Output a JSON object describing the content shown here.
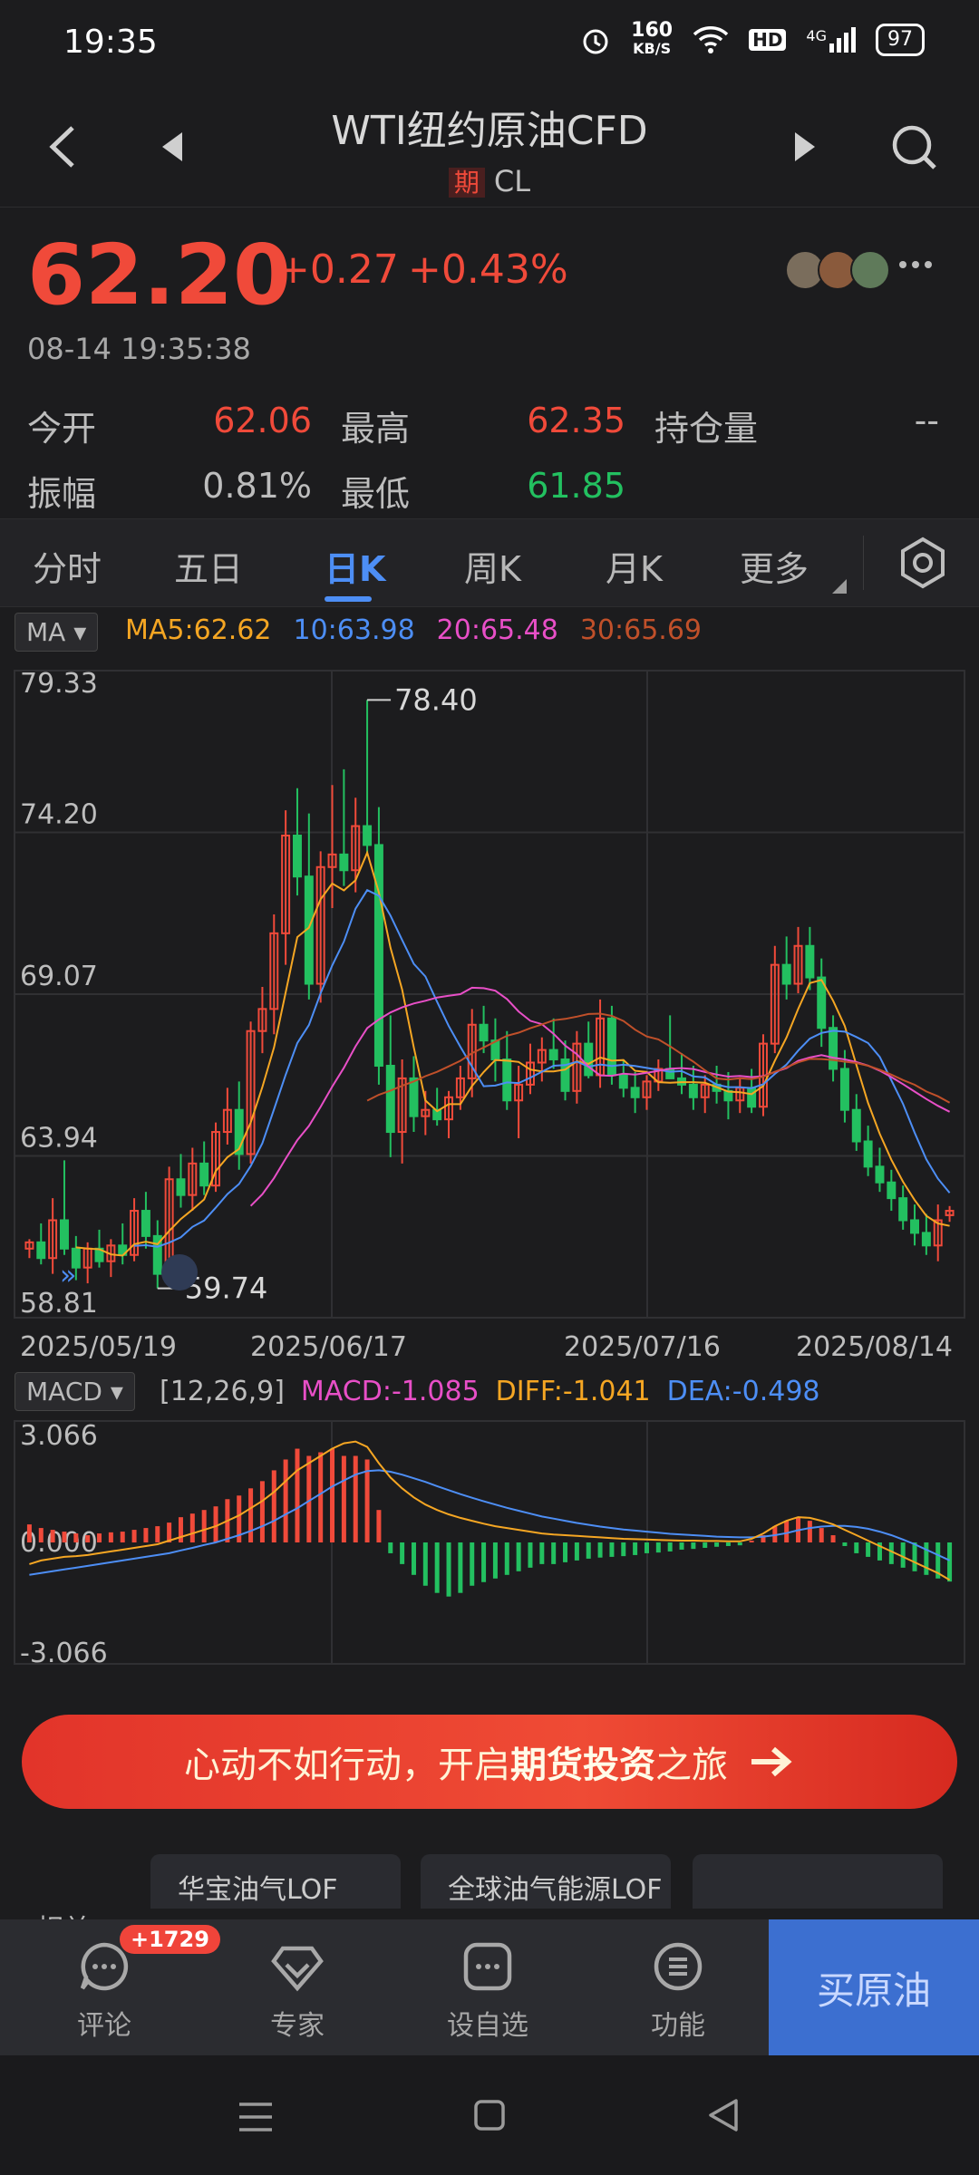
{
  "status": {
    "time": "19:35",
    "net_speed": "160",
    "net_unit": "KB/S",
    "hd": "HD",
    "signal": "4G",
    "battery": "97"
  },
  "header": {
    "title": "WTI纽约原油CFD",
    "tag": "期",
    "code": "CL"
  },
  "quote": {
    "price": "62.20",
    "change": "+0.27",
    "change_pct": "+0.43%",
    "datetime": "08-14 19:35:38"
  },
  "stats": [
    {
      "label": "今开",
      "value": "62.06",
      "color": "red"
    },
    {
      "label": "最高",
      "value": "62.35",
      "color": "red"
    },
    {
      "label": "持仓量",
      "value": "--",
      "color": "gray"
    },
    {
      "label": "振幅",
      "value": "0.81%",
      "color": "gray"
    },
    {
      "label": "最低",
      "value": "61.85",
      "color": "green"
    }
  ],
  "tabs": [
    "分时",
    "五日",
    "日K",
    "周K",
    "月K",
    "更多"
  ],
  "active_tab": "日K",
  "ma_legend": {
    "selector": "MA",
    "ma5": "MA5:62.62",
    "ma10": "10:63.98",
    "ma20": "20:65.48",
    "ma30": "30:65.69"
  },
  "macd_legend": {
    "selector": "MACD",
    "params": "[12,26,9]",
    "macd": "MACD:-1.085",
    "diff": "DIFF:-1.041",
    "dea": "DEA:-0.498"
  },
  "colors": {
    "up": "#f04a3a",
    "down": "#23c060",
    "ma5": "#f5a623",
    "ma10": "#4d8ef5",
    "ma20": "#e84fc7",
    "ma30": "#c0502a",
    "accent": "#4d8ef5"
  },
  "chart_data": [
    {
      "type": "candlestick",
      "y_ticks": [
        "79.33",
        "74.20",
        "69.07",
        "63.94",
        "58.81"
      ],
      "ylim": [
        58.81,
        79.33
      ],
      "x_ticks": [
        "2025/05/19",
        "2025/06/17",
        "2025/07/16",
        "2025/08/14"
      ],
      "high_marker": "78.40",
      "low_marker": "59.74",
      "candles": [
        [
          61.0,
          61.3,
          60.7,
          61.2
        ],
        [
          61.2,
          61.8,
          60.5,
          60.7
        ],
        [
          60.7,
          62.6,
          60.2,
          61.9
        ],
        [
          61.9,
          63.8,
          60.8,
          61.0
        ],
        [
          61.0,
          61.4,
          60.0,
          60.4
        ],
        [
          60.4,
          61.2,
          59.9,
          61.0
        ],
        [
          61.0,
          61.6,
          60.4,
          60.6
        ],
        [
          60.6,
          61.3,
          60.1,
          61.1
        ],
        [
          61.1,
          61.8,
          60.5,
          60.8
        ],
        [
          60.8,
          62.6,
          60.6,
          62.2
        ],
        [
          62.2,
          62.8,
          61.0,
          61.4
        ],
        [
          61.4,
          61.9,
          59.74,
          60.2
        ],
        [
          60.2,
          63.6,
          60.0,
          63.2
        ],
        [
          63.2,
          64.0,
          62.3,
          62.7
        ],
        [
          62.7,
          64.2,
          62.2,
          63.7
        ],
        [
          63.7,
          64.4,
          62.7,
          63.0
        ],
        [
          63.0,
          65.0,
          62.8,
          64.7
        ],
        [
          64.7,
          66.1,
          64.3,
          65.4
        ],
        [
          65.4,
          66.3,
          63.5,
          64.0
        ],
        [
          64.0,
          68.2,
          63.7,
          67.9
        ],
        [
          67.9,
          69.3,
          67.2,
          68.6
        ],
        [
          68.6,
          71.6,
          67.8,
          71.0
        ],
        [
          71.0,
          74.9,
          70.0,
          74.1
        ],
        [
          74.1,
          75.6,
          72.2,
          72.8
        ],
        [
          72.8,
          74.8,
          68.9,
          69.4
        ],
        [
          69.4,
          73.6,
          68.8,
          73.1
        ],
        [
          73.1,
          75.7,
          71.8,
          73.5
        ],
        [
          73.5,
          76.2,
          72.5,
          73.0
        ],
        [
          73.0,
          75.3,
          72.3,
          74.4
        ],
        [
          74.4,
          78.4,
          73.5,
          73.8
        ],
        [
          73.8,
          75.0,
          66.2,
          66.8
        ],
        [
          66.8,
          68.4,
          63.9,
          64.7
        ],
        [
          64.7,
          67.0,
          63.7,
          66.4
        ],
        [
          66.4,
          67.1,
          64.7,
          65.2
        ],
        [
          65.2,
          66.0,
          64.6,
          65.4
        ],
        [
          65.4,
          66.1,
          64.9,
          65.1
        ],
        [
          65.1,
          66.0,
          64.5,
          65.8
        ],
        [
          65.8,
          66.8,
          65.4,
          66.4
        ],
        [
          66.4,
          68.6,
          65.8,
          68.1
        ],
        [
          68.1,
          68.7,
          67.2,
          67.6
        ],
        [
          67.6,
          68.3,
          66.3,
          67.0
        ],
        [
          67.0,
          67.9,
          65.4,
          65.7
        ],
        [
          65.7,
          66.8,
          64.5,
          66.2
        ],
        [
          66.2,
          67.5,
          65.9,
          66.9
        ],
        [
          66.9,
          67.7,
          66.3,
          67.3
        ],
        [
          67.3,
          68.3,
          66.7,
          67.0
        ],
        [
          67.0,
          67.6,
          65.7,
          66.0
        ],
        [
          66.0,
          67.9,
          65.6,
          67.5
        ],
        [
          67.5,
          68.2,
          66.4,
          66.5
        ],
        [
          66.5,
          68.9,
          66.1,
          68.3
        ],
        [
          68.3,
          68.7,
          66.2,
          66.5
        ],
        [
          66.5,
          67.0,
          65.8,
          66.1
        ],
        [
          66.1,
          66.6,
          65.3,
          65.8
        ],
        [
          65.8,
          66.5,
          65.4,
          66.3
        ],
        [
          66.3,
          67.0,
          66.0,
          66.7
        ],
        [
          66.7,
          68.4,
          66.5,
          66.4
        ],
        [
          66.4,
          67.2,
          65.9,
          66.2
        ],
        [
          66.2,
          66.8,
          65.4,
          65.8
        ],
        [
          65.8,
          66.5,
          65.3,
          66.2
        ],
        [
          66.2,
          66.8,
          65.6,
          66.0
        ],
        [
          66.0,
          66.6,
          65.1,
          65.7
        ],
        [
          65.7,
          66.4,
          65.3,
          66.1
        ],
        [
          66.1,
          66.7,
          65.3,
          65.5
        ],
        [
          65.5,
          67.8,
          65.2,
          67.5
        ],
        [
          67.5,
          70.6,
          67.2,
          70.0
        ],
        [
          70.0,
          70.9,
          68.9,
          69.4
        ],
        [
          69.4,
          71.2,
          69.1,
          70.6
        ],
        [
          70.6,
          71.2,
          69.2,
          69.6
        ],
        [
          69.6,
          70.2,
          67.4,
          68.0
        ],
        [
          68.0,
          68.4,
          66.3,
          66.7
        ],
        [
          66.7,
          67.3,
          65.0,
          65.4
        ],
        [
          65.4,
          65.9,
          64.1,
          64.4
        ],
        [
          64.4,
          64.9,
          63.3,
          63.6
        ],
        [
          63.6,
          64.2,
          62.8,
          63.1
        ],
        [
          63.1,
          63.5,
          62.2,
          62.6
        ],
        [
          62.6,
          63.0,
          61.6,
          61.9
        ],
        [
          61.9,
          62.4,
          61.1,
          61.5
        ],
        [
          61.5,
          62.1,
          60.8,
          61.1
        ],
        [
          61.1,
          62.4,
          60.6,
          61.9
        ],
        [
          62.06,
          62.35,
          61.85,
          62.2
        ]
      ]
    },
    {
      "type": "macd",
      "y_ticks": [
        "3.066",
        "0.000",
        "-3.066"
      ],
      "ylim": [
        -3.066,
        3.066
      ],
      "hist": [
        0.5,
        0.4,
        0.35,
        0.3,
        0.25,
        0.2,
        0.25,
        0.28,
        0.3,
        0.35,
        0.4,
        0.45,
        0.55,
        0.7,
        0.8,
        0.9,
        1.0,
        1.2,
        1.3,
        1.5,
        1.7,
        2.0,
        2.3,
        2.6,
        2.4,
        2.5,
        2.6,
        2.4,
        2.4,
        2.3,
        0.9,
        -0.3,
        -0.6,
        -0.9,
        -1.2,
        -1.4,
        -1.5,
        -1.4,
        -1.2,
        -1.1,
        -1.0,
        -0.9,
        -0.8,
        -0.7,
        -0.6,
        -0.6,
        -0.55,
        -0.5,
        -0.45,
        -0.42,
        -0.4,
        -0.38,
        -0.35,
        -0.3,
        -0.28,
        -0.25,
        -0.2,
        -0.18,
        -0.15,
        -0.12,
        -0.1,
        -0.08,
        0.05,
        0.2,
        0.45,
        0.6,
        0.7,
        0.6,
        0.4,
        0.2,
        -0.1,
        -0.3,
        -0.4,
        -0.5,
        -0.6,
        -0.7,
        -0.8,
        -0.9,
        -1.0,
        -1.085
      ],
      "diff": [
        -0.6,
        -0.5,
        -0.45,
        -0.4,
        -0.38,
        -0.35,
        -0.3,
        -0.25,
        -0.2,
        -0.15,
        -0.1,
        -0.05,
        0.05,
        0.15,
        0.25,
        0.35,
        0.45,
        0.6,
        0.75,
        0.95,
        1.15,
        1.4,
        1.7,
        2.0,
        2.2,
        2.4,
        2.6,
        2.75,
        2.8,
        2.65,
        2.2,
        1.8,
        1.5,
        1.25,
        1.05,
        0.9,
        0.78,
        0.68,
        0.6,
        0.52,
        0.45,
        0.4,
        0.35,
        0.3,
        0.25,
        0.22,
        0.2,
        0.18,
        0.16,
        0.14,
        0.12,
        0.1,
        0.09,
        0.08,
        0.07,
        0.06,
        0.05,
        0.05,
        0.04,
        0.04,
        0.03,
        0.03,
        0.1,
        0.25,
        0.45,
        0.6,
        0.7,
        0.68,
        0.6,
        0.5,
        0.35,
        0.2,
        0.05,
        -0.1,
        -0.25,
        -0.4,
        -0.55,
        -0.7,
        -0.85,
        -1.041
      ],
      "dea": [
        -0.9,
        -0.85,
        -0.8,
        -0.75,
        -0.7,
        -0.65,
        -0.6,
        -0.55,
        -0.5,
        -0.45,
        -0.4,
        -0.35,
        -0.3,
        -0.22,
        -0.15,
        -0.07,
        0.0,
        0.1,
        0.2,
        0.32,
        0.45,
        0.6,
        0.78,
        0.95,
        1.15,
        1.35,
        1.55,
        1.72,
        1.88,
        1.98,
        2.0,
        1.96,
        1.88,
        1.78,
        1.68,
        1.56,
        1.45,
        1.34,
        1.24,
        1.14,
        1.05,
        0.96,
        0.88,
        0.8,
        0.72,
        0.66,
        0.6,
        0.54,
        0.49,
        0.44,
        0.4,
        0.36,
        0.33,
        0.3,
        0.27,
        0.24,
        0.22,
        0.2,
        0.18,
        0.16,
        0.15,
        0.14,
        0.14,
        0.16,
        0.2,
        0.26,
        0.34,
        0.4,
        0.44,
        0.46,
        0.46,
        0.43,
        0.38,
        0.3,
        0.2,
        0.08,
        -0.05,
        -0.2,
        -0.35,
        -0.498
      ]
    }
  ],
  "banner": {
    "text_a": "心动不如行动，开启",
    "text_b": "期货投资",
    "text_c": "之旅"
  },
  "cards": [
    "华宝油气LOF",
    "全球油气能源LOF",
    ""
  ],
  "cards_side": "相关",
  "bottom_nav": [
    {
      "label": "评论",
      "badge": "+1729"
    },
    {
      "label": "专家"
    },
    {
      "label": "设自选"
    },
    {
      "label": "功能"
    }
  ],
  "buy_label": "买原油"
}
